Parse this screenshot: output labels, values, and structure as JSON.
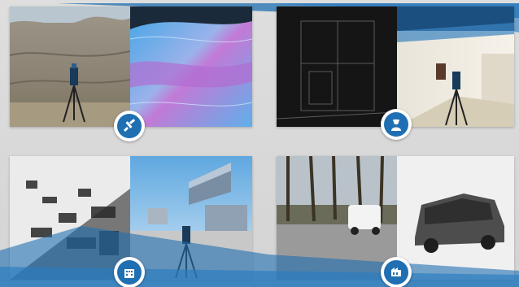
{
  "colors": {
    "accent_blue": "#1f6fb2",
    "light_blue": "#4fa3d9",
    "background_gray": "#d6d6d6"
  },
  "panels": [
    {
      "name": "panel-outcrop",
      "subject": "geology"
    },
    {
      "name": "panel-indoor",
      "subject": "building-interior"
    },
    {
      "name": "panel-architecture",
      "subject": "architecture"
    },
    {
      "name": "panel-vehicle",
      "subject": "vehicle"
    }
  ],
  "badges": [
    {
      "icon": "geologist-hammer-icon"
    },
    {
      "icon": "engineer-person-icon"
    },
    {
      "icon": "building-icon"
    },
    {
      "icon": "vehicle-factory-icon"
    }
  ]
}
